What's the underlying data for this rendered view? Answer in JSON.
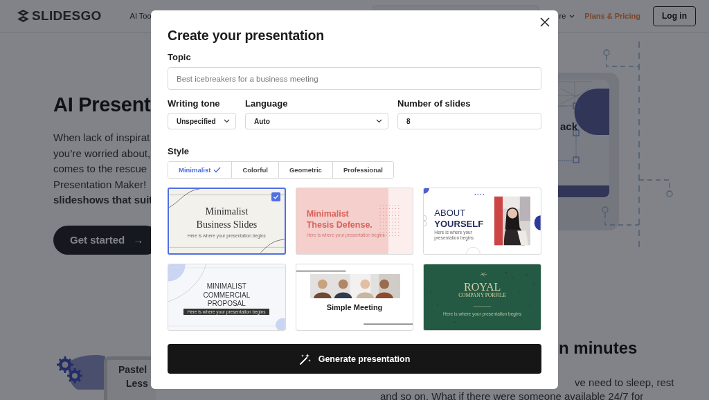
{
  "header": {
    "logo": "SLIDESGO",
    "nav": [
      {
        "label": "AI Too",
        "dropdown": false
      },
      {
        "label": "re",
        "dropdown": true
      }
    ],
    "plans_link": "Plans & Pricing",
    "login_button": "Log in"
  },
  "hero": {
    "title": "AI Present",
    "paragraph_lines": [
      "When lack of inspirat",
      "you’re worried about,",
      "comes to the rescue",
      "Presentation Maker!",
      "**slideshows that suit**"
    ],
    "cta": {
      "label": "Get started",
      "arrow": "→"
    }
  },
  "illustration": {
    "label": "ack"
  },
  "lower": {
    "card_title_lines": [
      "Pastel",
      "Less"
    ],
    "heading": "n minutes",
    "line_1": "ve need to sleep, rest",
    "line_2": "and so on. What if there were someone available 24/7 for"
  },
  "dialog": {
    "title": "Create your presentation",
    "topic": {
      "label": "Topic",
      "placeholder": "Best icebreakers for a business meeting"
    },
    "fields": [
      {
        "kind": "select",
        "label": "Writing tone",
        "value": "Unspecified"
      },
      {
        "kind": "select",
        "label": "Language",
        "value": "Auto"
      },
      {
        "kind": "number",
        "label": "Number of slides",
        "value": "8"
      }
    ],
    "style": {
      "label": "Style",
      "tabs": [
        {
          "label": "Minimalist",
          "selected": true
        },
        {
          "label": "Colorful",
          "selected": false
        },
        {
          "label": "Geometric",
          "selected": false
        },
        {
          "label": "Professional",
          "selected": false
        }
      ]
    },
    "templates": [
      {
        "kind": "business",
        "title_lines": [
          "Minimalist",
          "Business Slides"
        ],
        "subtitle": "Here is where your presentation begins",
        "selected": true
      },
      {
        "kind": "thesis",
        "title_lines": [
          "Minimalist",
          "Thesis Defense."
        ],
        "subtitle": "Here is where your presentation begins",
        "selected": false
      },
      {
        "kind": "about",
        "title_lines": [
          "ABOUT",
          "YOURSELF"
        ],
        "subtitle": "Here is where your presentation begins",
        "selected": false
      },
      {
        "kind": "proposal",
        "title_lines": [
          "MINIMALIST",
          "COMMERCIAL",
          "PROPOSAL"
        ],
        "subtitle": "Here is where your presentation begins",
        "selected": false
      },
      {
        "kind": "meeting",
        "title_lines": [
          "Simple Meeting"
        ],
        "selected": false
      },
      {
        "kind": "royal",
        "title_lines": [
          "ROYAL",
          "COMPANY PORFILE"
        ],
        "subtitle": "Here is where your presentation begins",
        "selected": false
      }
    ],
    "generate_button": "Generate presentation"
  }
}
